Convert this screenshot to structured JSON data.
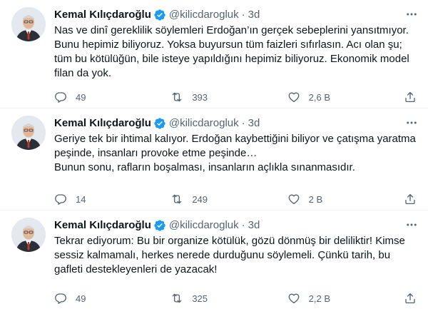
{
  "colors": {
    "verified_badge": "#1d9bf0",
    "secondary_text": "#536471",
    "primary_text": "#0f1419"
  },
  "icons": {
    "verified": "verified-badge-icon",
    "reply": "reply-icon",
    "retweet": "retweet-icon",
    "like": "heart-icon",
    "share": "share-icon",
    "more": "more-options-icon"
  },
  "tweets": [
    {
      "author_name": "Kemal Kılıçdaroğlu",
      "handle": "@kilicdarogluk",
      "separator": "·",
      "time": "3d",
      "lines": [
        "Nas ve dinî gereklilik söylemleri Erdoğan’ın gerçek sebeplerini yansıtmıyor.",
        "Bunu hepimiz biliyoruz. Yoksa buyursun tüm faizleri sıfırlasın. Acı olan şu;",
        "tüm bu kötülüğün, bile isteye yapıldığını hepimiz biliyoruz. Ekonomik model",
        "filan da yok."
      ],
      "replies": "49",
      "retweets": "393",
      "likes": "2,6 B"
    },
    {
      "author_name": "Kemal Kılıçdaroğlu",
      "handle": "@kilicdarogluk",
      "separator": "·",
      "time": "3d",
      "lines": [
        "Geriye tek bir ihtimal kalıyor. Erdoğan kaybettiğini biliyor ve çatışma yaratma",
        "peşinde, insanları provoke etme peşinde…",
        "Bunun sonu, rafların boşalması, insanların açlıkla sınanmasıdır."
      ],
      "replies": "14",
      "retweets": "249",
      "likes": "2 B"
    },
    {
      "author_name": "Kemal Kılıçdaroğlu",
      "handle": "@kilicdarogluk",
      "separator": "·",
      "time": "3d",
      "lines": [
        "Tekrar ediyorum: Bu bir organize kötülük, gözü dönmüş bir deliliktir! Kimse",
        "sessiz kalmamalı, herkes nerede durduğunu söylemeli. Çünkü tarih, bu",
        "gafleti destekleyenleri de yazacak!"
      ],
      "replies": "49",
      "retweets": "325",
      "likes": "2,2 B"
    }
  ]
}
